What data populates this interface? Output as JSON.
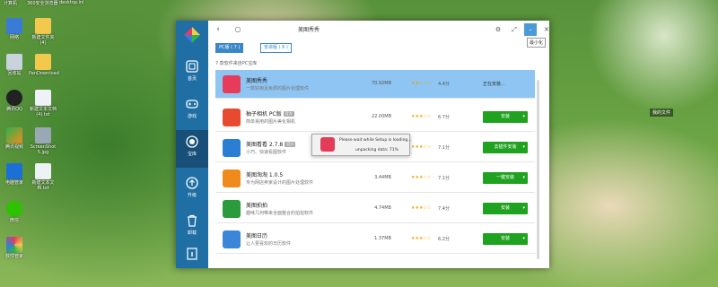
{
  "desktop": {
    "top_labels": [
      "计算机",
      "360安全浏览器",
      "desktop.ini"
    ],
    "icons": [
      {
        "label": "网络",
        "name": "network-icon"
      },
      {
        "label": "新建文件夹(4)",
        "name": "folder-icon"
      },
      {
        "label": "回收站",
        "name": "recycle-bin-icon"
      },
      {
        "label": "PanDownload",
        "name": "folder-icon"
      },
      {
        "label": "腾讯QQ",
        "name": "qq-icon"
      },
      {
        "label": "新建文本文档(4).txt",
        "name": "text-file-icon"
      },
      {
        "label": "腾讯视频",
        "name": "tencent-video-icon"
      },
      {
        "label": "ScreenShot 5.jpg",
        "name": "image-file-icon"
      },
      {
        "label": "电脑管家",
        "name": "pc-manager-icon"
      },
      {
        "label": "新建文本文档.txt",
        "name": "text-file-icon"
      },
      {
        "label": "微信",
        "name": "wechat-icon"
      },
      {
        "label": "软件管家",
        "name": "software-manager-icon"
      }
    ],
    "right_label": "我的文件"
  },
  "window": {
    "search_text": "美图秀秀",
    "tooltip": "最小化",
    "sidebar": [
      {
        "label": "首页",
        "icon": "home-icon"
      },
      {
        "label": "游戏",
        "icon": "game-icon"
      },
      {
        "label": "宝库",
        "icon": "treasury-icon"
      },
      {
        "label": "升级",
        "icon": "upgrade-icon"
      },
      {
        "label": "卸载",
        "icon": "trash-icon"
      }
    ],
    "tabs": [
      {
        "label": "PC版 ( 7 )",
        "active": true
      },
      {
        "label": "安卓版 ( 6 )",
        "active": false
      }
    ],
    "result_note": "7 款软件来自PC宝库",
    "rows": [
      {
        "name": "美图秀秀",
        "badge": "",
        "desc": "一款好用且免费的图片处理软件",
        "size": "70.92MB",
        "score": "4.4分",
        "action": "正在安装...",
        "icon_color": "#e63b5a"
      },
      {
        "name": "柚子相机 PC版",
        "badge": "官方",
        "desc": "简单易用的图片美化相机",
        "size": "22.00MB",
        "score": "6.7分",
        "action": "安装",
        "icon_color": "#e84a2f"
      },
      {
        "name": "美图看看 2.7.8",
        "badge": "官方",
        "desc": "小巧、快速看图软件",
        "size": "",
        "score": "7.1分",
        "action": "去插件安装",
        "icon_color": "#2a7fd4"
      },
      {
        "name": "美图淘淘 1.0.5",
        "badge": "",
        "desc": "专为网店卖家设计的图片处理软件",
        "size": "3.44MB",
        "score": "7.1分",
        "action": "一键安装",
        "icon_color": "#f08a1c"
      },
      {
        "name": "美图拍拍",
        "badge": "",
        "desc": "趣味几何带来全面整合的拍拍软件",
        "size": "4.74MB",
        "score": "7.4分",
        "action": "安装",
        "icon_color": "#2c9b3c"
      },
      {
        "name": "美图日历",
        "badge": "",
        "desc": "让人更喜欢的日历软件",
        "size": "1.37MB",
        "score": "6.2分",
        "action": "安装",
        "icon_color": "#3b86d8"
      }
    ],
    "dialog": {
      "line1": "Please wait while Setup is loading...",
      "line2": "unpacking data: 71%"
    }
  },
  "colors": {
    "sidebar": "#1f6fa5",
    "selected_row": "#8ec5f2",
    "install_button": "#1fa21f"
  }
}
